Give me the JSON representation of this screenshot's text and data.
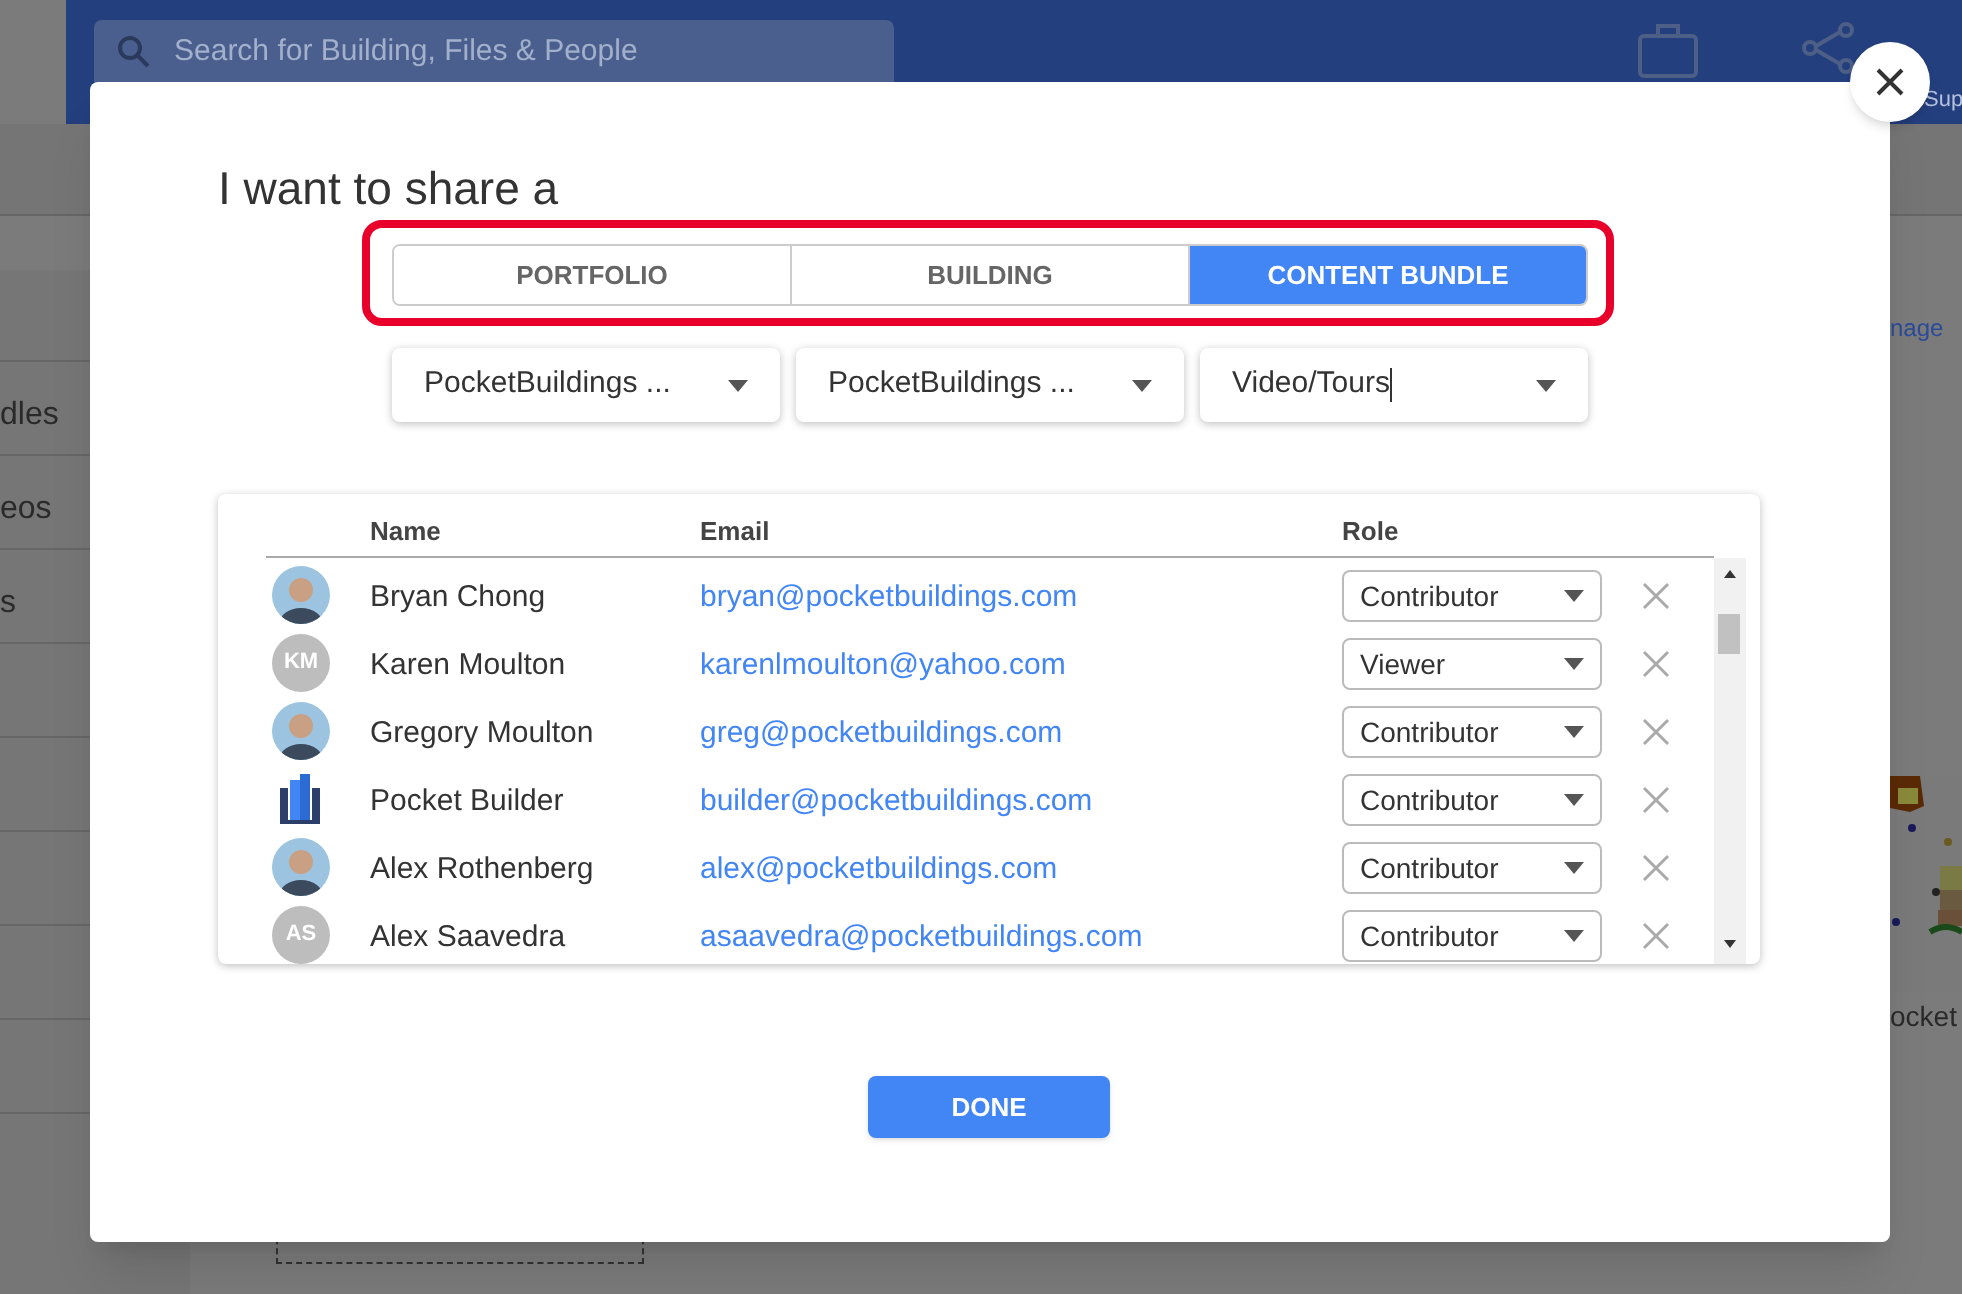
{
  "background": {
    "search": {
      "placeholder": "Search for Building, Files & People"
    },
    "header_label": "Sup",
    "sidebar_items": [
      "dles",
      "eos",
      "s"
    ],
    "link_fragment": "nage",
    "thumbnail": {
      "kind": "picture",
      "caption": "ocket"
    }
  },
  "dialog": {
    "title": "I want to share a",
    "share_types": [
      {
        "label": "PORTFOLIO",
        "selected": false
      },
      {
        "label": "BUILDING",
        "selected": false
      },
      {
        "label": "CONTENT BUNDLE",
        "selected": true
      }
    ],
    "filters": [
      {
        "value": "PocketBuildings ..."
      },
      {
        "value": "PocketBuildings ..."
      },
      {
        "value": "Video/Tours",
        "focused": true
      }
    ],
    "table": {
      "columns": [
        "Name",
        "Email",
        "Role"
      ],
      "rows": [
        {
          "name": "Bryan Chong",
          "email": "bryan@pocketbuildings.com",
          "role": "Contributor"
        },
        {
          "avatar": {
            "kind": "initials",
            "text": "KM"
          },
          "name": "Karen Moulton",
          "email": "karenlmoulton@yahoo.com",
          "role": "Viewer"
        },
        {
          "name": "Gregory Moulton",
          "email": "greg@pocketbuildings.com",
          "role": "Contributor"
        },
        {
          "avatar": {
            "kind": "logo"
          },
          "name": "Pocket Builder",
          "email": "builder@pocketbuildings.com",
          "role": "Contributor"
        },
        {
          "name": "Alex Rothenberg",
          "email": "alex@pocketbuildings.com",
          "role": "Contributor"
        },
        {
          "avatar": {
            "kind": "initials",
            "text": "AS"
          },
          "name": "Alex Saavedra",
          "email": "asaavedra@pocketbuildings.com",
          "role": "Contributor"
        }
      ]
    },
    "done_button": "DONE"
  }
}
